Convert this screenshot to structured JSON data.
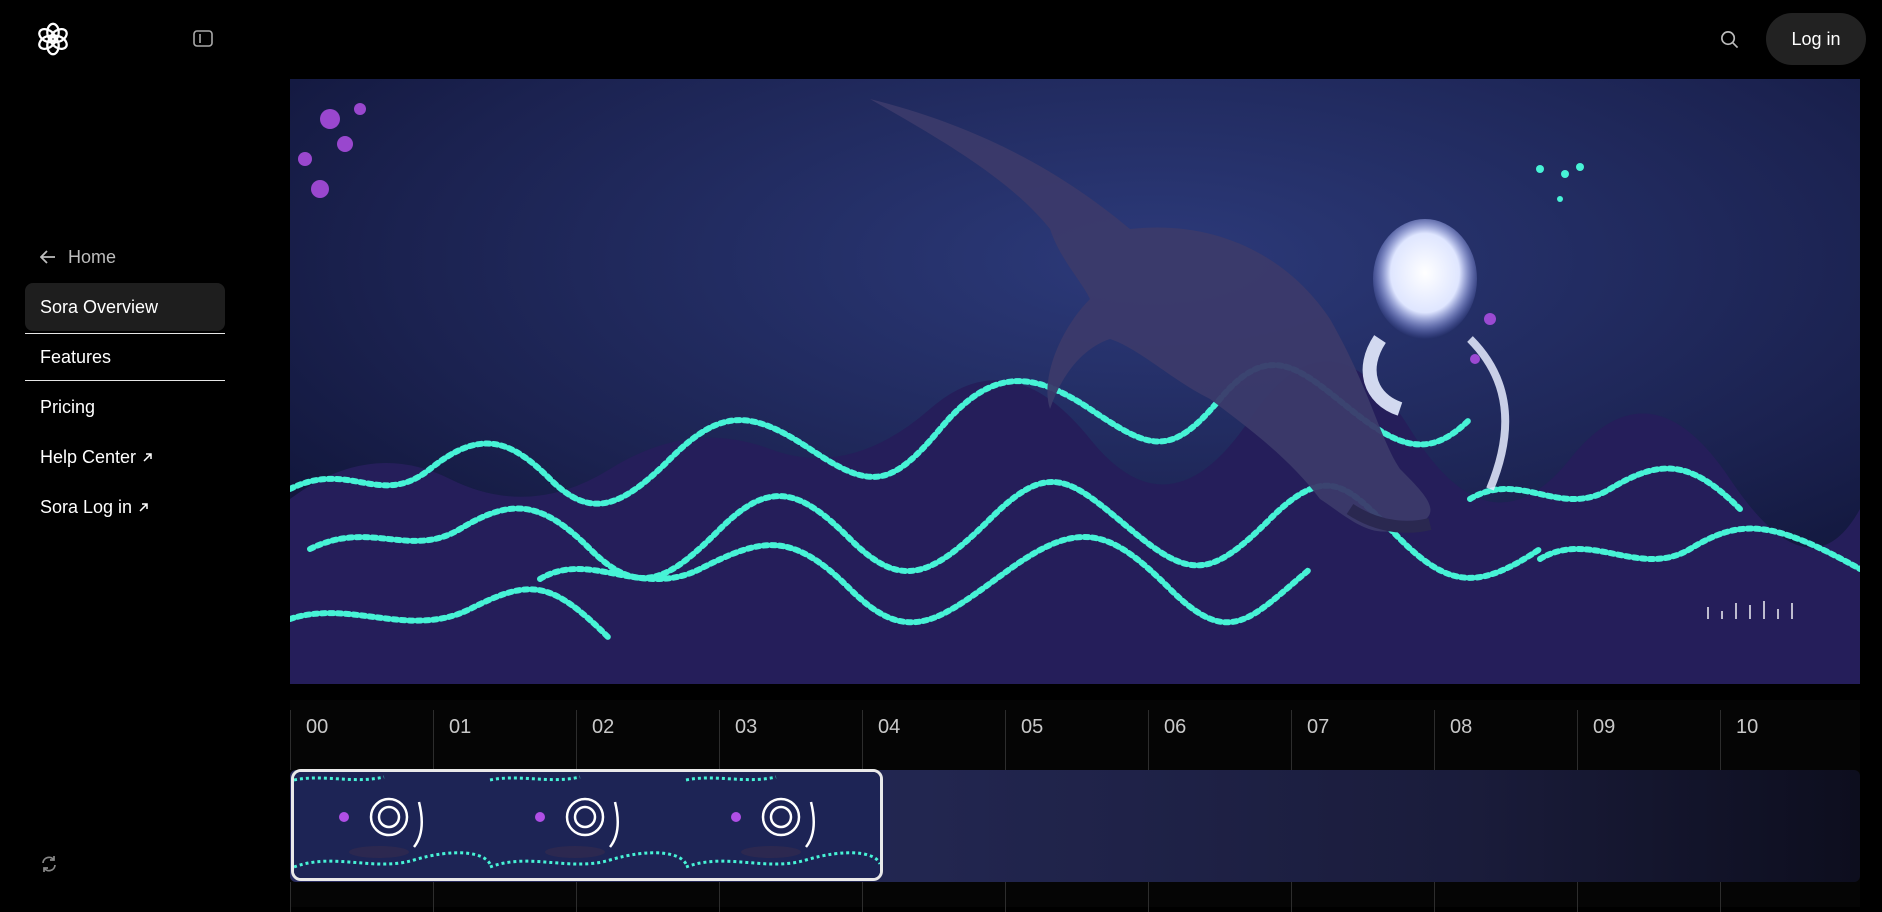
{
  "brand": {
    "logo_icon": "openai-logo-icon"
  },
  "header": {
    "sidebar_toggle_icon": "sidebar-toggle-icon",
    "search_icon": "search-icon",
    "login_label": "Log in"
  },
  "nav": {
    "home_label": "Home",
    "items": [
      {
        "label": "Sora Overview",
        "active": true
      },
      {
        "label": "Features"
      },
      {
        "label": "Pricing"
      },
      {
        "label": "Help Center",
        "external": true
      },
      {
        "label": "Sora Log in",
        "external": true
      }
    ]
  },
  "timeline": {
    "ticks": [
      "00",
      "01",
      "02",
      "03",
      "04",
      "05",
      "06",
      "07",
      "08",
      "09",
      "10"
    ]
  },
  "colors": {
    "accent_track": "#2a2d60",
    "glow": "#40f0d0"
  }
}
